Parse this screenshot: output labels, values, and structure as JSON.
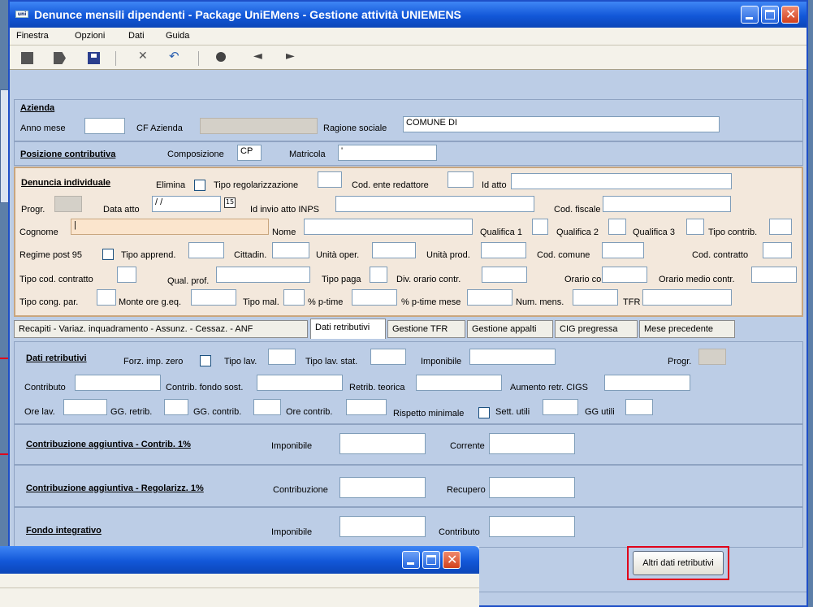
{
  "window": {
    "title": "Denunce mensili dipendenti - Package UniEMens - Gestione attività UNIEMENS",
    "icon_text": "uniemens"
  },
  "menu": [
    "Finestra",
    "Opzioni",
    "Dati",
    "Guida"
  ],
  "toolbar_icons": [
    "new-icon",
    "open-icon",
    "save-icon",
    "cut-icon",
    "undo-icon",
    "search-icon",
    "back-arrow-icon",
    "forward-arrow-icon"
  ],
  "azienda": {
    "heading": "Azienda",
    "anno_mese_label": "Anno mese",
    "anno_mese": "",
    "cf_label": "CF Azienda",
    "cf": "",
    "ragione_label": "Ragione sociale",
    "ragione": "COMUNE DI"
  },
  "posizione": {
    "heading": "Posizione contributiva",
    "composizione_label": "Composizione",
    "composizione": "CP",
    "matricola_label": "Matricola",
    "matricola": "'"
  },
  "denuncia": {
    "heading": "Denuncia individuale",
    "elimina": "Elimina",
    "tipo_reg": "Tipo regolarizzazione",
    "cod_ente": "Cod. ente redattore",
    "id_atto": "Id atto",
    "progr": "Progr.",
    "data_atto_label": "Data atto",
    "data_atto": "/ /",
    "calendar_icon": "15",
    "id_invio": "Id invio atto INPS",
    "cod_fiscale": "Cod. fiscale",
    "cognome": "Cognome",
    "cognome_val": "|",
    "nome": "Nome",
    "qualifica1": "Qualifica 1",
    "qualifica2": "Qualifica 2",
    "qualifica3": "Qualifica 3",
    "tipo_contrib": "Tipo contrib.",
    "regime": "Regime post 95",
    "tipo_apprend": "Tipo apprend.",
    "cittadin": "Cittadin.",
    "unita_oper": "Unità oper.",
    "unita_prod": "Unità prod.",
    "cod_comune": "Cod. comune",
    "cod_contratto": "Cod. contratto",
    "tipo_cod_contratto": "Tipo cod. contratto",
    "qual_prof": "Qual. prof.",
    "tipo_paga": "Tipo paga",
    "div_orario": "Div. orario contr.",
    "orario_contr": "Orario contr.",
    "orario_medio": "Orario medio contr.",
    "tipo_cong": "Tipo cong. par.",
    "monte_ore": "Monte ore g.eq.",
    "tipo_mal": "Tipo mal.",
    "ptime": "% p-time",
    "ptime_mese": "% p-time mese",
    "num_mens": "Num. mens.",
    "tfr": "TFR"
  },
  "tabs": [
    "Recapiti - Variaz. inquadramento - Assunz. - Cessaz. - ANF",
    "Dati retributivi",
    "Gestione TFR",
    "Gestione appalti",
    "CIG pregressa",
    "Mese precedente"
  ],
  "active_tab": 1,
  "retrib": {
    "heading": "Dati retributivi",
    "forz": "Forz. imp. zero",
    "tipo_lav": "Tipo lav.",
    "tipo_lav_stat": "Tipo lav. stat.",
    "imponibile": "Imponibile",
    "progr": "Progr.",
    "contributo": "Contributo",
    "contrib_fondo": "Contrib. fondo sost.",
    "retrib_teorica": "Retrib. teorica",
    "aumento": "Aumento retr. CIGS",
    "ore_lav": "Ore lav.",
    "gg_retrib": "GG. retrib.",
    "gg_contrib": "GG. contrib.",
    "ore_contrib": "Ore contrib.",
    "rispetto": "Rispetto minimale",
    "sett_utili": "Sett. utili",
    "gg_utili": "GG utili"
  },
  "contrib1": {
    "heading": "Contribuzione aggiuntiva - Contrib. 1%",
    "l1": "Imponibile",
    "l2": "Corrente"
  },
  "contrib2": {
    "heading": "Contribuzione aggiuntiva - Regolarizz. 1%",
    "l1": "Contribuzione",
    "l2": "Recupero"
  },
  "fondo": {
    "heading": "Fondo integrativo",
    "l1": "Imponibile",
    "l2": "Contributo"
  },
  "altri_button": "Altri dati retributivi",
  "colors": {
    "title_blue": "#1257d8",
    "panel": "#bccde6",
    "beige": "#f3e8dc",
    "highlight_red": "#e0001a"
  }
}
